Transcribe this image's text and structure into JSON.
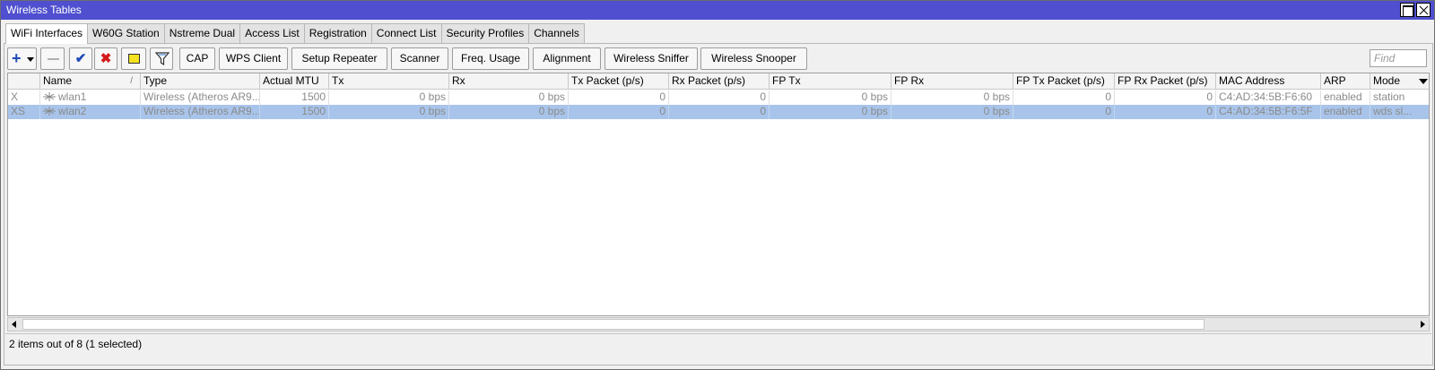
{
  "window": {
    "title": "Wireless Tables"
  },
  "tabs": [
    {
      "label": "WiFi Interfaces"
    },
    {
      "label": "W60G Station"
    },
    {
      "label": "Nstreme Dual"
    },
    {
      "label": "Access List"
    },
    {
      "label": "Registration"
    },
    {
      "label": "Connect List"
    },
    {
      "label": "Security Profiles"
    },
    {
      "label": "Channels"
    }
  ],
  "toolbar": {
    "cap_label": "CAP",
    "wps_label": "WPS Client",
    "setup_repeater_label": "Setup Repeater",
    "scanner_label": "Scanner",
    "freq_usage_label": "Freq. Usage",
    "alignment_label": "Alignment",
    "sniffer_label": "Wireless Sniffer",
    "snooper_label": "Wireless Snooper",
    "find_placeholder": "Find",
    "sort_mark": "/"
  },
  "table": {
    "headers": [
      "Name",
      "Type",
      "Actual MTU",
      "Tx",
      "Rx",
      "Tx Packet (p/s)",
      "Rx Packet (p/s)",
      "FP Tx",
      "FP Rx",
      "FP Tx Packet (p/s)",
      "FP Rx Packet (p/s)",
      "MAC Address",
      "ARP",
      "Mode"
    ],
    "rows": [
      {
        "flag": "X",
        "name": "wlan1",
        "type": "Wireless (Atheros AR9...",
        "mtu": "1500",
        "tx": "0 bps",
        "rx": "0 bps",
        "txp": "0",
        "rxp": "0",
        "fptx": "0 bps",
        "fprx": "0 bps",
        "fptxp": "0",
        "fprxp": "0",
        "mac": "C4:AD:34:5B:F6:60",
        "arp": "enabled",
        "mode": "station"
      },
      {
        "flag": "XS",
        "name": "wlan2",
        "type": "Wireless (Atheros AR9...",
        "mtu": "1500",
        "tx": "0 bps",
        "rx": "0 bps",
        "txp": "0",
        "rxp": "0",
        "fptx": "0 bps",
        "fprx": "0 bps",
        "fptxp": "0",
        "fprxp": "0",
        "mac": "C4:AD:34:5B:F6:5F",
        "arp": "enabled",
        "mode": "wds sl..."
      }
    ]
  },
  "status": {
    "text": "2 items out of 8 (1 selected)"
  },
  "colors": {
    "titlebar": "#4f4fcf",
    "selection": "#a9c4ea",
    "add_icon": "#1e4bb5",
    "remove_icon": "#d41a1a"
  }
}
